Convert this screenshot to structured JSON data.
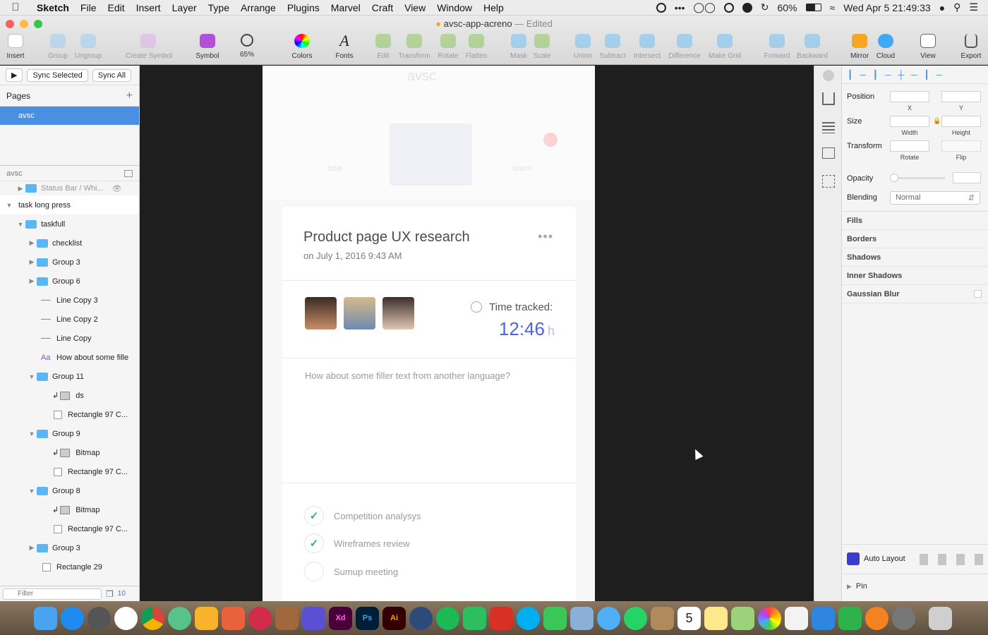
{
  "menubar": {
    "app_name": "Sketch",
    "items": [
      "File",
      "Edit",
      "Insert",
      "Layer",
      "Type",
      "Arrange",
      "Plugins",
      "Marvel",
      "Craft",
      "View",
      "Window",
      "Help"
    ],
    "battery": "60%",
    "clock": "Wed Apr 5  21:49:33"
  },
  "window": {
    "doc_name": "avsc-app-acreno",
    "edited_label": "— Edited"
  },
  "toolbar": {
    "insert": "Insert",
    "group": "Group",
    "ungroup": "Ungroup",
    "create_symbol": "Create Symbol",
    "symbol": "Symbol",
    "zoom": "65%",
    "colors": "Colors",
    "fonts": "Fonts",
    "edit": "Edit",
    "transform": "Transform",
    "rotate": "Rotate",
    "flatten": "Flatten",
    "mask": "Mask",
    "scale": "Scale",
    "union": "Union",
    "subtract": "Subtract",
    "intersect": "Intersect",
    "difference": "Difference",
    "make_grid": "Make Grid",
    "forward": "Forward",
    "backward": "Backward",
    "mirror": "Mirror",
    "cloud": "Cloud",
    "view": "View",
    "export": "Export"
  },
  "left_panel": {
    "sync_selected": "Sync Selected",
    "sync_all": "Sync All",
    "pages_title": "Pages",
    "pages": [
      "avsc"
    ],
    "layers_page": "avsc",
    "layers": [
      {
        "label": "Status Bar / Whi..."
      },
      {
        "label": "task long press"
      },
      {
        "label": "taskfull"
      },
      {
        "label": "checklist"
      },
      {
        "label": "Group 3"
      },
      {
        "label": "Group 6"
      },
      {
        "label": "Line Copy 3"
      },
      {
        "label": "Line Copy 2"
      },
      {
        "label": "Line Copy"
      },
      {
        "label": "How about some fille"
      },
      {
        "label": "Group 11"
      },
      {
        "label": "ds"
      },
      {
        "label": "Rectangle 97 C..."
      },
      {
        "label": "Group 9"
      },
      {
        "label": "Bitmap"
      },
      {
        "label": "Rectangle 97 C..."
      },
      {
        "label": "Group 8"
      },
      {
        "label": "Bitmap"
      },
      {
        "label": "Rectangle 97 C..."
      },
      {
        "label": "Group 3"
      },
      {
        "label": "Rectangle 29"
      }
    ],
    "filter_placeholder": "Filter",
    "layer_count": "10"
  },
  "artboard": {
    "ghost_logo": "avsc",
    "ghost_tab_left": "tarie",
    "ghost_tab_right": "alarm",
    "card": {
      "title": "Product page UX research",
      "date": "on July 1, 2016 9:43 AM",
      "time_tracked_label": "Time tracked:",
      "time_value": "12:46",
      "time_unit": "h",
      "filler": "How about some filler text from another language?",
      "todos": [
        {
          "label": "Competition analysys",
          "done": true
        },
        {
          "label": "Wireframes review",
          "done": true
        },
        {
          "label": "Sumup meeting",
          "done": false
        }
      ]
    }
  },
  "inspector": {
    "position": "Position",
    "x": "X",
    "y": "Y",
    "size": "Size",
    "width": "Width",
    "height": "Height",
    "transform": "Transform",
    "rotate": "Rotate",
    "flip": "Flip",
    "opacity": "Opacity",
    "blending": "Blending",
    "blending_value": "Normal",
    "fills": "Fills",
    "borders": "Borders",
    "shadows": "Shadows",
    "inner_shadows": "Inner Shadows",
    "gaussian_blur": "Gaussian Blur",
    "auto_layout": "Auto Layout",
    "pin": "Pin"
  },
  "dock": {
    "xd": "Xd",
    "ps": "Ps",
    "ai": "Ai",
    "calendar_day": "5"
  }
}
